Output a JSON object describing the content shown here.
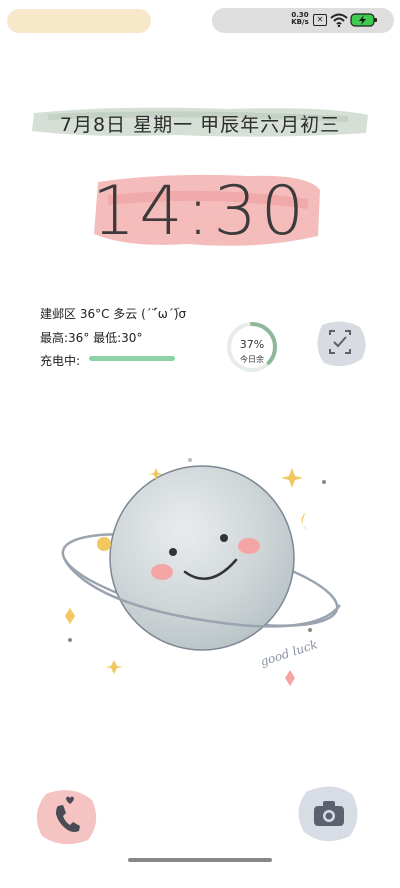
{
  "status_bar": {
    "net_speed_value": "0.30",
    "net_speed_unit": "KB/s",
    "notification_icon": "x-box-icon",
    "wifi_icon": "wifi-icon",
    "battery_icon": "battery-charging-icon",
    "battery_color": "#3ecb4f"
  },
  "lock": {
    "date": "7月8日  星期一  甲辰年六月初三",
    "time": "14:30"
  },
  "info": {
    "weather": "建邺区 36°C 多云 (´ۜۜ´ω´ۜۜ)σ",
    "temp_range": "最高:36°  最低:30°",
    "charging_label": "充电中:",
    "charge_level": 1.0,
    "charge_color": "#8fd2a8"
  },
  "day_ring": {
    "percent": "37%",
    "label": "今日余",
    "value": 0.37
  },
  "illustration": {
    "caption": "good luck"
  },
  "colors": {
    "date_brush": "#cfd9cf",
    "clock_brush": "#f0a7a5",
    "ring": "#8fb89a"
  }
}
